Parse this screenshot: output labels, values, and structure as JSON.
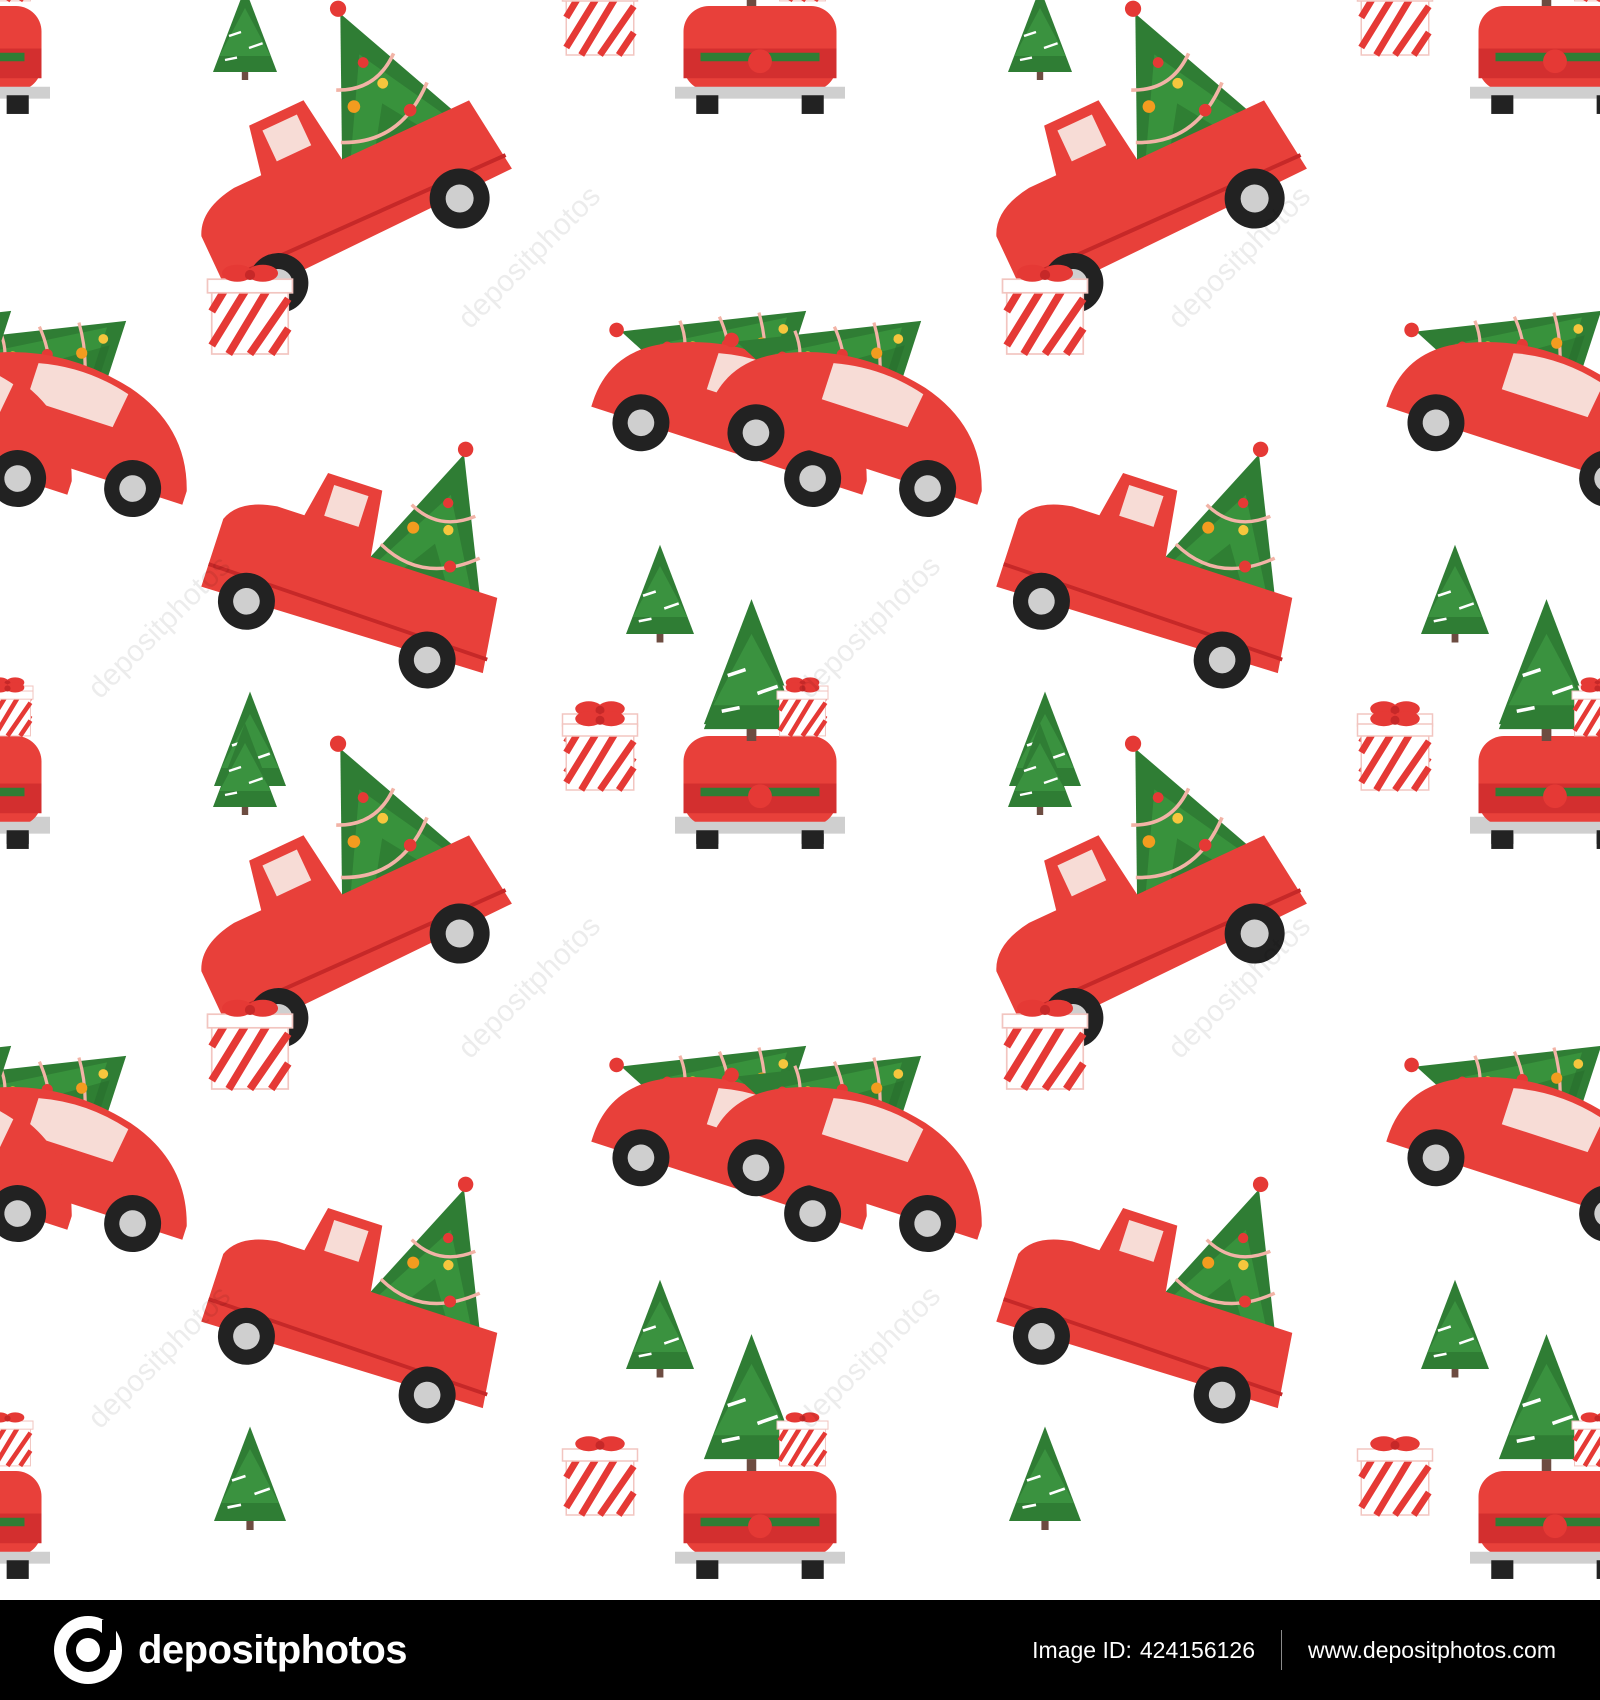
{
  "footer": {
    "brand": "depositphotos",
    "image_id_label": "Image ID:",
    "image_id": "424156126",
    "site_url": "www.depositphotos.com"
  },
  "watermark": {
    "text": "depositphotos"
  },
  "pattern": {
    "background": "#ffffff",
    "car_red": "#e8403a",
    "tree_green": "#2e7d32",
    "ornament_orange": "#f39c1f",
    "gift_red": "#e53935"
  }
}
